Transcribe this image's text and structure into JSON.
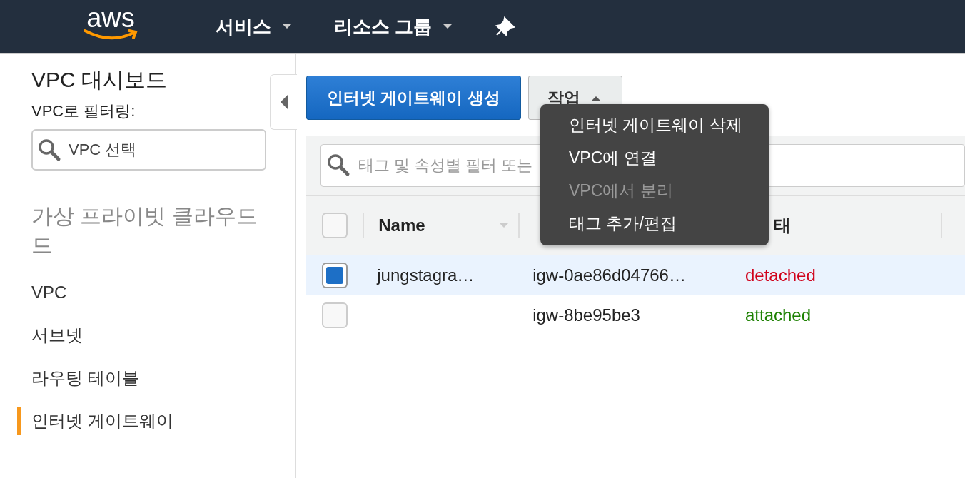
{
  "logo": "aws",
  "top_nav": {
    "items": [
      {
        "label": "서비스"
      },
      {
        "label": "리소스 그룹"
      }
    ]
  },
  "sidebar": {
    "title": "VPC 대시보드",
    "filter_label": "VPC로 필터링:",
    "filter": {
      "placeholder": "VPC 선택"
    },
    "section": "가상 프라이빗 클라우드 드",
    "items": [
      {
        "label": "VPC",
        "selected": false
      },
      {
        "label": "서브넷",
        "selected": false
      },
      {
        "label": "라우팅 테이블",
        "selected": false
      },
      {
        "label": "인터넷 게이트웨이",
        "selected": true
      }
    ]
  },
  "toolbar": {
    "create_button": "인터넷 게이트웨이 생성",
    "actions_button": "작업",
    "actions_expanded": true
  },
  "actions_menu": [
    {
      "label": "인터넷 게이트웨이 삭제",
      "disabled": false
    },
    {
      "label": "VPC에 연결",
      "disabled": false
    },
    {
      "label": "VPC에서 분리",
      "disabled": true
    },
    {
      "label": "태그 추가/편집",
      "disabled": false
    }
  ],
  "search": {
    "placeholder": "태그 및 속성별 필터 또는"
  },
  "table": {
    "select_all": {
      "checked": false
    },
    "columns": [
      {
        "label": "Name",
        "sortable": true
      },
      {
        "sortable": false
      },
      {
        "label": "태",
        "sortable": false
      }
    ],
    "rows": [
      {
        "selected": true,
        "name": "jungstagra…",
        "id": "igw-0ae86d04766…",
        "state": "detached",
        "color": "#d0021b"
      },
      {
        "selected": false,
        "id": "igw-8be95be3",
        "state": "attached",
        "color": "#1d8102"
      }
    ]
  }
}
